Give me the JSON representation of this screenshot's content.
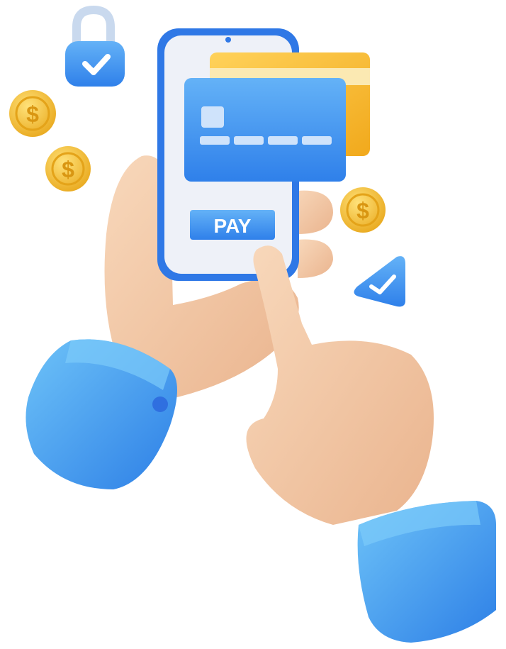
{
  "illustration": {
    "pay_button_label": "PAY",
    "colors": {
      "primary_blue": "#3f8ff0",
      "dark_blue": "#2f6fe0",
      "light_blue": "#6fb4f6",
      "card_yellow": "#f4b92e",
      "coin_gold": "#f3c33d",
      "skin": "#f2c9a5",
      "phone_screen": "#eef1f8",
      "background": "#ffffff"
    },
    "icons": [
      "padlock-check-icon",
      "dollar-coin-icon",
      "check-triangle-icon",
      "credit-card-icon"
    ]
  }
}
